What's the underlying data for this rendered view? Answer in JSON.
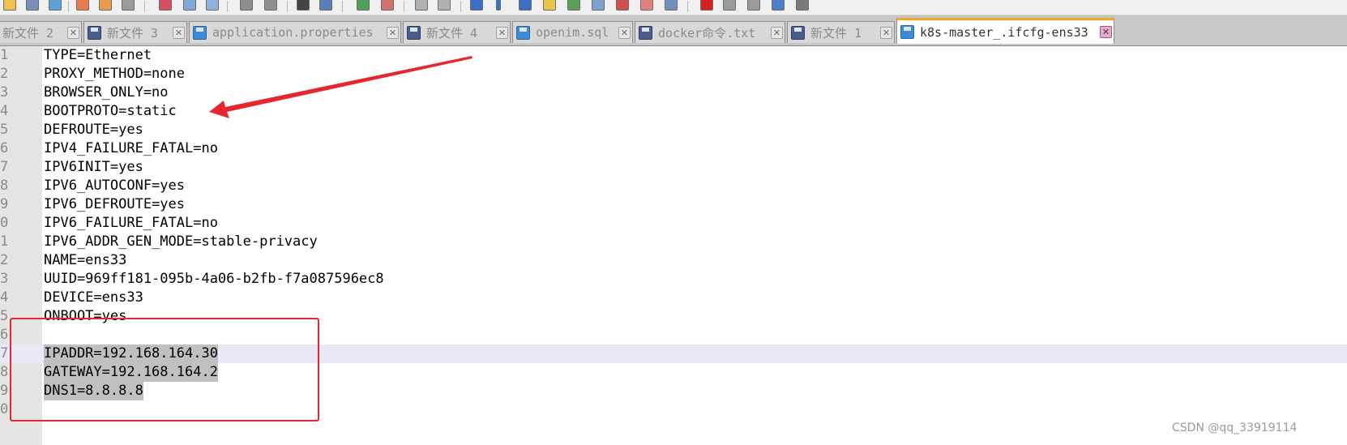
{
  "tabs": [
    {
      "label": "新文件 2",
      "icon": "disk-icon",
      "active": false
    },
    {
      "label": "新文件 3",
      "icon": "disk-icon",
      "active": false
    },
    {
      "label": "application.properties",
      "icon": "disk-icon",
      "active": false
    },
    {
      "label": "新文件 4",
      "icon": "disk-icon",
      "active": false
    },
    {
      "label": "openim.sql",
      "icon": "disk-icon",
      "active": false
    },
    {
      "label": "docker命令.txt",
      "icon": "disk-icon",
      "active": false
    },
    {
      "label": "新文件 1",
      "icon": "disk-icon",
      "active": false
    },
    {
      "label": "k8s-master_.ifcfg-ens33",
      "icon": "disk-icon",
      "active": true
    }
  ],
  "editor": {
    "lines": [
      {
        "num": "1",
        "text": "TYPE=Ethernet"
      },
      {
        "num": "2",
        "text": "PROXY_METHOD=none"
      },
      {
        "num": "3",
        "text": "BROWSER_ONLY=no"
      },
      {
        "num": "4",
        "text": "BOOTPROTO=static"
      },
      {
        "num": "5",
        "text": "DEFROUTE=yes"
      },
      {
        "num": "6",
        "text": "IPV4_FAILURE_FATAL=no"
      },
      {
        "num": "7",
        "text": "IPV6INIT=yes"
      },
      {
        "num": "8",
        "text": "IPV6_AUTOCONF=yes"
      },
      {
        "num": "9",
        "text": "IPV6_DEFROUTE=yes"
      },
      {
        "num": "0",
        "text": "IPV6_FAILURE_FATAL=no"
      },
      {
        "num": "1",
        "text": "IPV6_ADDR_GEN_MODE=stable-privacy"
      },
      {
        "num": "2",
        "text": "NAME=ens33"
      },
      {
        "num": "3",
        "text": "UUID=969ff181-095b-4a06-b2fb-f7a087596ec8"
      },
      {
        "num": "4",
        "text": "DEVICE=ens33"
      },
      {
        "num": "5",
        "text": "ONBOOT=yes"
      },
      {
        "num": "6",
        "text": ""
      },
      {
        "num": "7",
        "text": "IPADDR=192.168.164.30"
      },
      {
        "num": "8",
        "text": "GATEWAY=192.168.164.2"
      },
      {
        "num": "9",
        "text": "DNS1=8.8.8.8"
      },
      {
        "num": "0",
        "text": ""
      }
    ]
  },
  "colors": {
    "annotation_red": "#e8262d",
    "selection_gray": "#c0c0c0",
    "current_line": "#e8e8f8",
    "active_tab_accent": "#f5a623"
  },
  "watermark": "CSDN @qq_33919114"
}
